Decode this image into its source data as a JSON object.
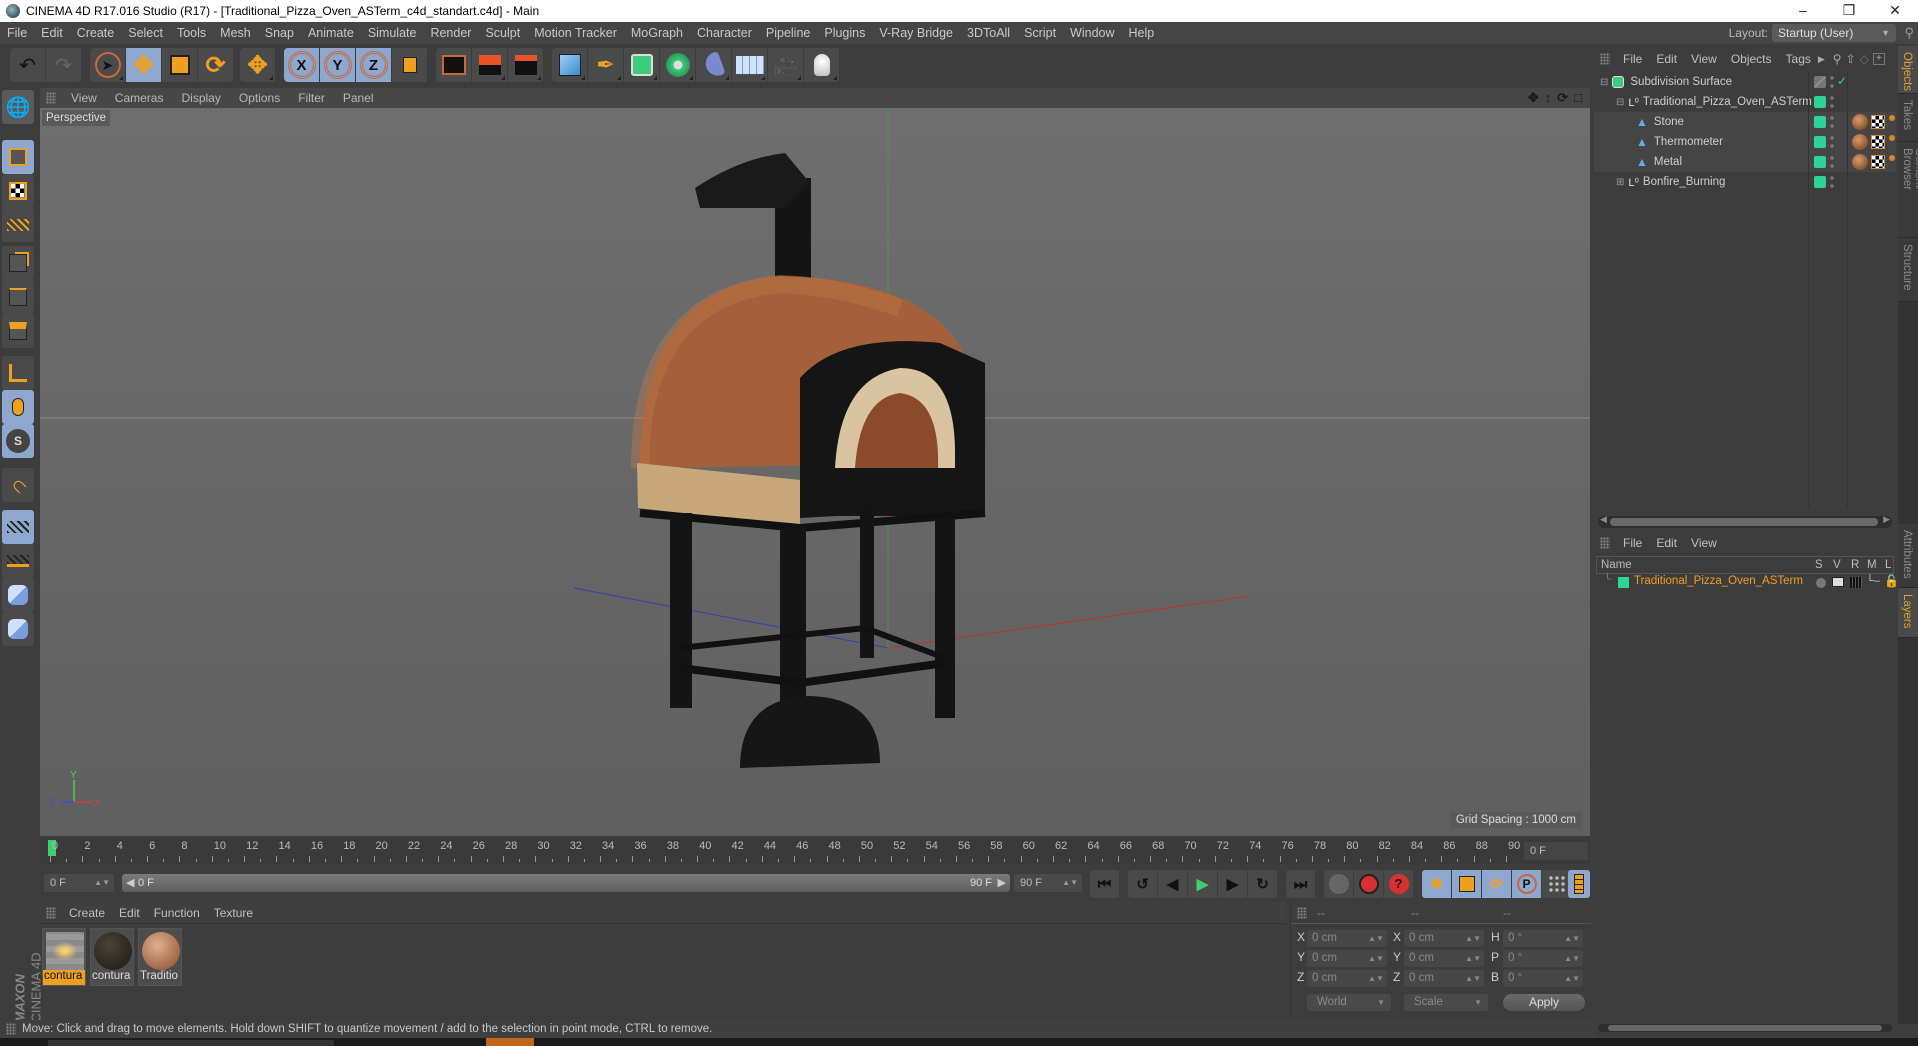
{
  "window": {
    "title": "CINEMA 4D R17.016 Studio (R17) - [Traditional_Pizza_Oven_ASTerm_c4d_standart.c4d] - Main",
    "controls": [
      "minimize",
      "restore",
      "close"
    ]
  },
  "menubar": {
    "items": [
      "File",
      "Edit",
      "Create",
      "Select",
      "Tools",
      "Mesh",
      "Snap",
      "Animate",
      "Simulate",
      "Render",
      "Sculpt",
      "Motion Tracker",
      "MoGraph",
      "Character",
      "Pipeline",
      "Plugins",
      "V-Ray Bridge",
      "3DToAll",
      "Script",
      "Window",
      "Help"
    ],
    "layout_label": "Layout:",
    "layout_value": "Startup (User)"
  },
  "toolbar": {
    "groups": [
      {
        "name": "history",
        "tools": [
          "undo-icon",
          "redo-icon"
        ]
      },
      {
        "name": "transform",
        "tools": [
          "live-selection-icon",
          "move-icon",
          "scale-icon",
          "rotate-icon"
        ],
        "active": [
          "move-icon"
        ]
      },
      {
        "name": "recent",
        "tools": [
          "recent-tool-icon"
        ]
      },
      {
        "name": "axis-lock",
        "tools": [
          "x-axis-icon",
          "y-axis-icon",
          "z-axis-icon",
          "coordinate-system-icon"
        ],
        "active": [
          "x-axis-icon",
          "y-axis-icon",
          "z-axis-icon"
        ]
      },
      {
        "name": "render",
        "tools": [
          "render-view-icon",
          "render-picture-viewer-icon",
          "render-settings-icon"
        ]
      },
      {
        "name": "create",
        "tools": [
          "cube-icon",
          "pen-spline-icon",
          "subdivision-surface-icon",
          "cloner-icon",
          "bend-deformer-icon",
          "floor-icon",
          "camera-icon",
          "light-icon"
        ]
      }
    ]
  },
  "left_tools": [
    "make-editable-icon",
    "model-mode-icon",
    "texture-mode-icon",
    "workplane-mode-icon",
    "points-mode-icon",
    "edges-mode-icon",
    "polygons-mode-icon",
    "axis-mode-icon",
    "tweak-mode-icon",
    "solo-icon",
    "snap-icon",
    "workplane-lock-icon",
    "workplane-align-icon",
    "python-icon",
    "python-icon-2"
  ],
  "viewport": {
    "menu": [
      "View",
      "Cameras",
      "Display",
      "Options",
      "Filter",
      "Panel"
    ],
    "camera_label": "Perspective",
    "grid_spacing": "Grid Spacing : 1000 cm",
    "axis_labels": {
      "x": "X",
      "y": "Y",
      "z": "Z"
    },
    "nav_icons": [
      "pan-icon",
      "zoom-icon",
      "orbit-icon",
      "maximize-icon"
    ]
  },
  "timeline": {
    "ticks": [
      0,
      2,
      4,
      6,
      8,
      10,
      12,
      14,
      16,
      18,
      20,
      22,
      24,
      26,
      28,
      30,
      32,
      34,
      36,
      38,
      40,
      42,
      44,
      46,
      48,
      50,
      52,
      54,
      56,
      58,
      60,
      62,
      64,
      66,
      68,
      70,
      72,
      74,
      76,
      78,
      80,
      82,
      84,
      86,
      88,
      90
    ],
    "current_frame": 0,
    "current_frame_field": "0 F",
    "start_field": "0 F",
    "range_start": "0 F",
    "range_end": "90 F",
    "end_field": "90 F"
  },
  "transport": {
    "playback": [
      "go-to-start-icon",
      "previous-key-icon",
      "previous-frame-icon",
      "play-icon",
      "next-frame-icon",
      "next-key-icon",
      "go-to-end-icon"
    ],
    "record": [
      "motion-record-icon",
      "autokey-icon",
      "keyframe-selection-icon"
    ],
    "key_types": [
      "key-position-icon",
      "key-scale-icon",
      "key-rotation-icon",
      "key-parameter-icon",
      "key-pla-icon"
    ],
    "timeline_button": "timeline-window-icon"
  },
  "materials": {
    "menu": [
      "Create",
      "Edit",
      "Function",
      "Texture"
    ],
    "items": [
      {
        "label": "contura",
        "selected": true,
        "color": "#8a7a6a"
      },
      {
        "label": "contura",
        "selected": false,
        "color": "#2a2620"
      },
      {
        "label": "Traditio",
        "selected": false,
        "color": "#b87a55"
      }
    ]
  },
  "coordinates": {
    "headers": [
      "--",
      "--",
      "--"
    ],
    "position": {
      "X": "0 cm",
      "Y": "0 cm",
      "Z": "0 cm"
    },
    "size": {
      "X": "0 cm",
      "Y": "0 cm",
      "Z": "0 cm"
    },
    "rotation": {
      "H": "0 °",
      "P": "0 °",
      "B": "0 °"
    },
    "mode_dropdown": "World",
    "scale_dropdown": "Scale",
    "apply_label": "Apply"
  },
  "object_manager": {
    "menu": [
      "File",
      "Edit",
      "View",
      "Objects",
      "Tags"
    ],
    "objects": [
      {
        "name": "Subdivision Surface",
        "type": "subdivision-surface-icon",
        "depth": 0,
        "expand": "minus"
      },
      {
        "name": "Traditional_Pizza_Oven_ASTerm",
        "type": "null-object-icon",
        "depth": 1,
        "expand": "minus"
      },
      {
        "name": "Stone",
        "type": "polygon-object-icon",
        "depth": 2,
        "tags": true
      },
      {
        "name": "Thermometer",
        "type": "polygon-object-icon",
        "depth": 2,
        "tags": true
      },
      {
        "name": "Metal",
        "type": "polygon-object-icon",
        "depth": 2,
        "tags": true
      },
      {
        "name": "Bonfire_Burning",
        "type": "null-object-icon",
        "depth": 1,
        "expand": "plus"
      }
    ]
  },
  "layers": {
    "menu": [
      "File",
      "Edit",
      "View"
    ],
    "columns": [
      "Name",
      "S",
      "V",
      "R",
      "M",
      "L"
    ],
    "rows": [
      {
        "name": "Traditional_Pizza_Oven_ASTerm",
        "color": "#2ed495"
      }
    ]
  },
  "side_tabs": [
    {
      "label": "Objects",
      "active": true
    },
    {
      "label": "Takes",
      "active": false
    },
    {
      "label": "Content Browser",
      "active": false
    },
    {
      "label": "Structure",
      "active": false
    },
    {
      "label": "Attributes",
      "active": false
    },
    {
      "label": "Layers",
      "active": true
    }
  ],
  "status": {
    "message": "Move: Click and drag to move elements. Hold down SHIFT to quantize movement / add to the selection in point mode, CTRL to remove."
  },
  "branding": {
    "maxon": "MAXON",
    "product": "CINEMA 4D"
  },
  "colors": {
    "accent": "#f0a020",
    "active_tool": "#8da7cf",
    "layer_green": "#2ed495",
    "play_green": "#3cd070"
  }
}
